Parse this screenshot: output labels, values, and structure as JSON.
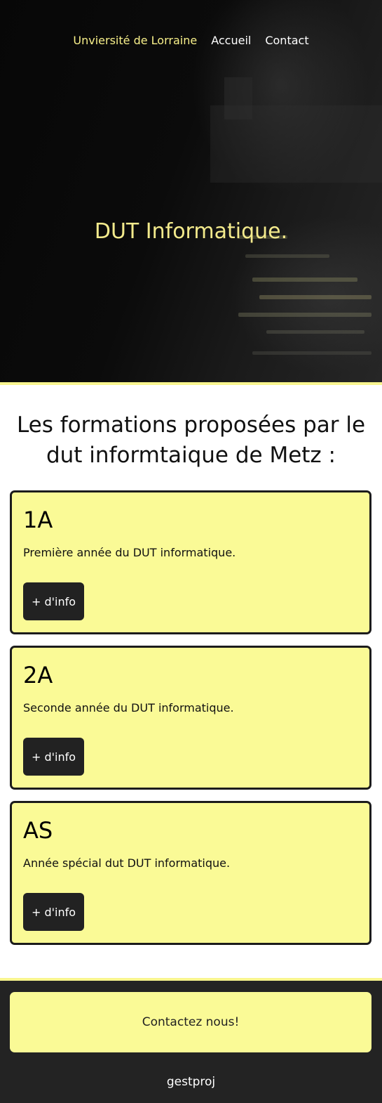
{
  "nav": {
    "brand": "Unviersité de Lorraine",
    "links": [
      "Accueil",
      "Contact"
    ]
  },
  "hero": {
    "title": "DUT Informatique."
  },
  "section": {
    "title": "Les formations proposées par le dut informtaique de Metz :"
  },
  "cards": [
    {
      "title": "1A",
      "description": "Première année du DUT informatique.",
      "button": "+ d'info"
    },
    {
      "title": "2A",
      "description": "Seconde année du DUT informatique.",
      "button": "+ d'info"
    },
    {
      "title": "AS",
      "description": "Année spécial dut DUT informatique.",
      "button": "+ d'info"
    }
  ],
  "footer": {
    "contact_button": "Contactez nous!",
    "text": "gestproj"
  },
  "colors": {
    "accent": "#fafa96",
    "dark": "#232323"
  }
}
